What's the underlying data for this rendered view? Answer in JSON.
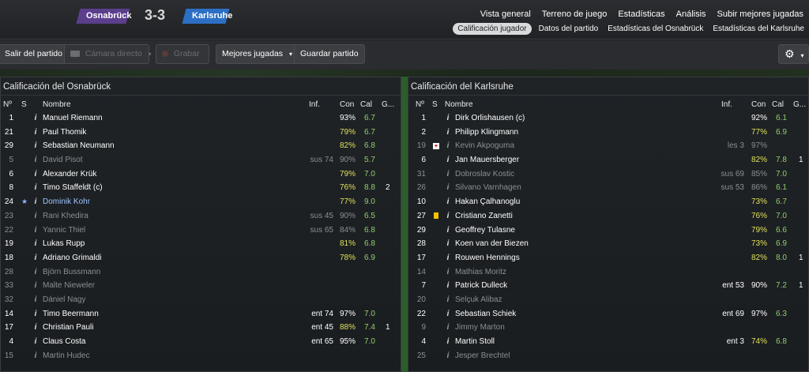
{
  "header": {
    "home_team": "Osnabrück",
    "away_team": "Karlsruhe",
    "score": "3-3",
    "nav": [
      "Vista general",
      "Terreno de juego",
      "Estadísticas",
      "Análisis",
      "Subir mejores jugadas"
    ],
    "subnav": [
      "Calificación jugador",
      "Datos del partido",
      "Estadísticas del Osnabrück",
      "Estadísticas del Karlsruhe"
    ],
    "active_subnav": "Calificación jugador"
  },
  "toolbar": {
    "exit_label": "Salir del partido",
    "camera_label": "Cámara directo",
    "record_label": "Grabar",
    "highlights_label": "Mejores jugadas",
    "save_label": "Guardar partido"
  },
  "columns": {
    "num": "Nº",
    "s": "S",
    "name": "Nombre",
    "inf": "Inf.",
    "con": "Con",
    "cal": "Cal",
    "goals": "G..."
  },
  "home_panel": {
    "title": "Calificación del Osnabrück",
    "players": [
      {
        "num": "1",
        "s": "",
        "name": "Manuel Riemann",
        "inf": "",
        "con": "93%",
        "cal": "6.7",
        "g": "",
        "dim": false,
        "con_color": "#ffffff"
      },
      {
        "num": "21",
        "s": "",
        "name": "Paul Thomik",
        "inf": "",
        "con": "79%",
        "cal": "6.7",
        "g": "",
        "dim": false,
        "con_color": "#e0e05a"
      },
      {
        "num": "29",
        "s": "",
        "name": "Sebastian Neumann",
        "inf": "",
        "con": "82%",
        "cal": "6.8",
        "g": "",
        "dim": false,
        "con_color": "#e0e05a"
      },
      {
        "num": "5",
        "s": "",
        "name": "David Pisot",
        "inf": "sus 74",
        "con": "90%",
        "cal": "5.7",
        "g": "",
        "dim": true,
        "con_color": "#ffffff"
      },
      {
        "num": "6",
        "s": "",
        "name": "Alexander Krük",
        "inf": "",
        "con": "79%",
        "cal": "7.0",
        "g": "",
        "dim": false,
        "con_color": "#e0e05a"
      },
      {
        "num": "8",
        "s": "",
        "name": "Timo Staffeldt (c)",
        "inf": "",
        "con": "76%",
        "cal": "8.8",
        "g": "2",
        "dim": false,
        "con_color": "#e0e05a"
      },
      {
        "num": "24",
        "s": "star",
        "name": "Dominik Kohr",
        "inf": "",
        "con": "77%",
        "cal": "9.0",
        "g": "",
        "dim": false,
        "link": true,
        "con_color": "#e0e05a"
      },
      {
        "num": "23",
        "s": "",
        "name": "Rani Khedira",
        "inf": "sus 45",
        "con": "90%",
        "cal": "6.5",
        "g": "",
        "dim": true,
        "con_color": "#ffffff"
      },
      {
        "num": "22",
        "s": "",
        "name": "Yannic Thiel",
        "inf": "sus 65",
        "con": "84%",
        "cal": "6.8",
        "g": "",
        "dim": true,
        "con_color": "#ffffff"
      },
      {
        "num": "19",
        "s": "",
        "name": "Lukas Rupp",
        "inf": "",
        "con": "81%",
        "cal": "6.8",
        "g": "",
        "dim": false,
        "con_color": "#e0e05a"
      },
      {
        "num": "18",
        "s": "",
        "name": "Adriano Grimaldi",
        "inf": "",
        "con": "78%",
        "cal": "6.9",
        "g": "",
        "dim": false,
        "con_color": "#e0e05a"
      },
      {
        "num": "28",
        "s": "",
        "name": "Björn Bussmann",
        "inf": "",
        "con": "",
        "cal": "",
        "g": "",
        "dim": true,
        "con_color": "#ffffff"
      },
      {
        "num": "33",
        "s": "",
        "name": "Malte Nieweler",
        "inf": "",
        "con": "",
        "cal": "",
        "g": "",
        "dim": true,
        "con_color": "#ffffff"
      },
      {
        "num": "32",
        "s": "",
        "name": "Dániel Nagy",
        "inf": "",
        "con": "",
        "cal": "",
        "g": "",
        "dim": true,
        "con_color": "#ffffff"
      },
      {
        "num": "14",
        "s": "",
        "name": "Timo Beermann",
        "inf": "ent 74",
        "con": "97%",
        "cal": "7.0",
        "g": "",
        "dim": false,
        "con_color": "#ffffff"
      },
      {
        "num": "17",
        "s": "",
        "name": "Christian Pauli",
        "inf": "ent 45",
        "con": "88%",
        "cal": "7.4",
        "g": "1",
        "dim": false,
        "con_color": "#e0e05a"
      },
      {
        "num": "4",
        "s": "",
        "name": "Claus Costa",
        "inf": "ent 65",
        "con": "95%",
        "cal": "7.0",
        "g": "",
        "dim": false,
        "con_color": "#ffffff"
      },
      {
        "num": "15",
        "s": "",
        "name": "Martin Hudec",
        "inf": "",
        "con": "",
        "cal": "",
        "g": "",
        "dim": true,
        "con_color": "#ffffff"
      }
    ]
  },
  "away_panel": {
    "title": "Calificación del Karlsruhe",
    "players": [
      {
        "num": "1",
        "s": "",
        "name": "Dirk Orlishausen (c)",
        "inf": "",
        "con": "92%",
        "cal": "6.1",
        "g": "",
        "dim": false,
        "con_color": "#ffffff"
      },
      {
        "num": "2",
        "s": "",
        "name": "Philipp Klingmann",
        "inf": "",
        "con": "77%",
        "cal": "6.9",
        "g": "",
        "dim": false,
        "con_color": "#e0e05a"
      },
      {
        "num": "19",
        "s": "injury",
        "name": "Kevin Akpoguma",
        "inf": "les 3",
        "con": "97%",
        "cal": "",
        "g": "",
        "dim": true,
        "con_color": "#ffffff"
      },
      {
        "num": "6",
        "s": "",
        "name": "Jan Mauersberger",
        "inf": "",
        "con": "82%",
        "cal": "7.8",
        "g": "1",
        "dim": false,
        "con_color": "#e0e05a"
      },
      {
        "num": "31",
        "s": "",
        "name": "Dobroslav Kostic",
        "inf": "sus 69",
        "con": "85%",
        "cal": "7.0",
        "g": "",
        "dim": true,
        "con_color": "#ffffff"
      },
      {
        "num": "26",
        "s": "",
        "name": "Silvano Varnhagen",
        "inf": "sus 53",
        "con": "86%",
        "cal": "6.1",
        "g": "",
        "dim": true,
        "con_color": "#ffffff"
      },
      {
        "num": "10",
        "s": "",
        "name": "Hakan Çalhanoglu",
        "inf": "",
        "con": "73%",
        "cal": "6.7",
        "g": "",
        "dim": false,
        "con_color": "#e0e05a"
      },
      {
        "num": "27",
        "s": "yellow",
        "name": "Cristiano Zanetti",
        "inf": "",
        "con": "76%",
        "cal": "7.0",
        "g": "",
        "dim": false,
        "con_color": "#e0e05a"
      },
      {
        "num": "29",
        "s": "",
        "name": "Geoffrey Tulasne",
        "inf": "",
        "con": "79%",
        "cal": "6.6",
        "g": "",
        "dim": false,
        "con_color": "#e0e05a"
      },
      {
        "num": "28",
        "s": "",
        "name": "Koen van der Biezen",
        "inf": "",
        "con": "73%",
        "cal": "6.9",
        "g": "",
        "dim": false,
        "con_color": "#e0e05a"
      },
      {
        "num": "17",
        "s": "",
        "name": "Rouwen Hennings",
        "inf": "",
        "con": "82%",
        "cal": "8.0",
        "g": "1",
        "dim": false,
        "con_color": "#e0e05a"
      },
      {
        "num": "14",
        "s": "",
        "name": "Mathias Moritz",
        "inf": "",
        "con": "",
        "cal": "",
        "g": "",
        "dim": true,
        "con_color": "#ffffff"
      },
      {
        "num": "7",
        "s": "",
        "name": "Patrick Dulleck",
        "inf": "ent 53",
        "con": "90%",
        "cal": "7.2",
        "g": "1",
        "dim": false,
        "con_color": "#ffffff"
      },
      {
        "num": "20",
        "s": "",
        "name": "Selçuk Alibaz",
        "inf": "",
        "con": "",
        "cal": "",
        "g": "",
        "dim": true,
        "con_color": "#ffffff"
      },
      {
        "num": "22",
        "s": "",
        "name": "Sebastian Schiek",
        "inf": "ent 69",
        "con": "97%",
        "cal": "6.3",
        "g": "",
        "dim": false,
        "con_color": "#ffffff"
      },
      {
        "num": "9",
        "s": "",
        "name": "Jimmy Marton",
        "inf": "",
        "con": "",
        "cal": "",
        "g": "",
        "dim": true,
        "con_color": "#ffffff"
      },
      {
        "num": "4",
        "s": "",
        "name": "Martin Stoll",
        "inf": "ent 3",
        "con": "74%",
        "cal": "6.8",
        "g": "",
        "dim": false,
        "con_color": "#e0e05a"
      },
      {
        "num": "25",
        "s": "",
        "name": "Jesper Brechtel",
        "inf": "",
        "con": "",
        "cal": "",
        "g": "",
        "dim": true,
        "con_color": "#ffffff"
      }
    ]
  }
}
